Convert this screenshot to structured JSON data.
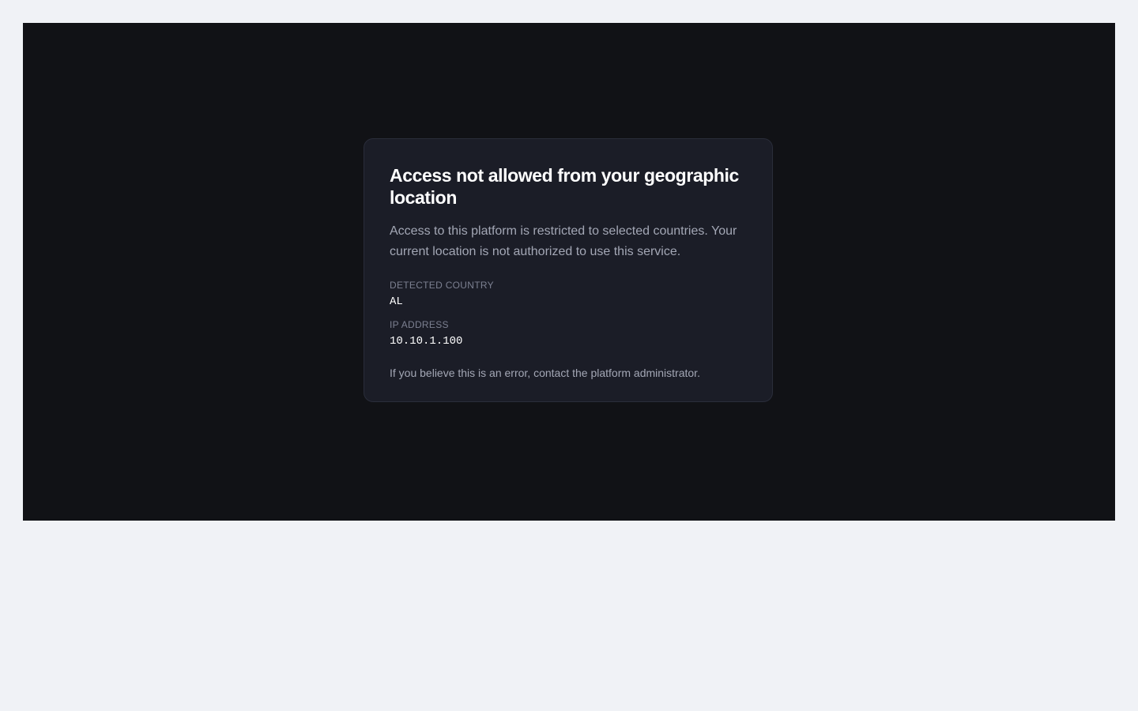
{
  "card": {
    "title": "Access not allowed from your geographic location",
    "description": "Access to this platform is restricted to selected countries. Your current location is not authorized to use this service.",
    "fields": [
      {
        "label": "DETECTED COUNTRY",
        "value": "AL"
      },
      {
        "label": "IP ADDRESS",
        "value": "10.10.1.100"
      }
    ],
    "note": "If you believe this is an error, contact the platform administrator."
  },
  "colors": {
    "page_background": "#f0f2f6",
    "frame_background": "#111216",
    "card_background": "#1b1d27",
    "card_border": "#2a2d3a",
    "title_text": "#ffffff",
    "body_text": "#a3a7b5",
    "label_text": "#7c8091"
  }
}
